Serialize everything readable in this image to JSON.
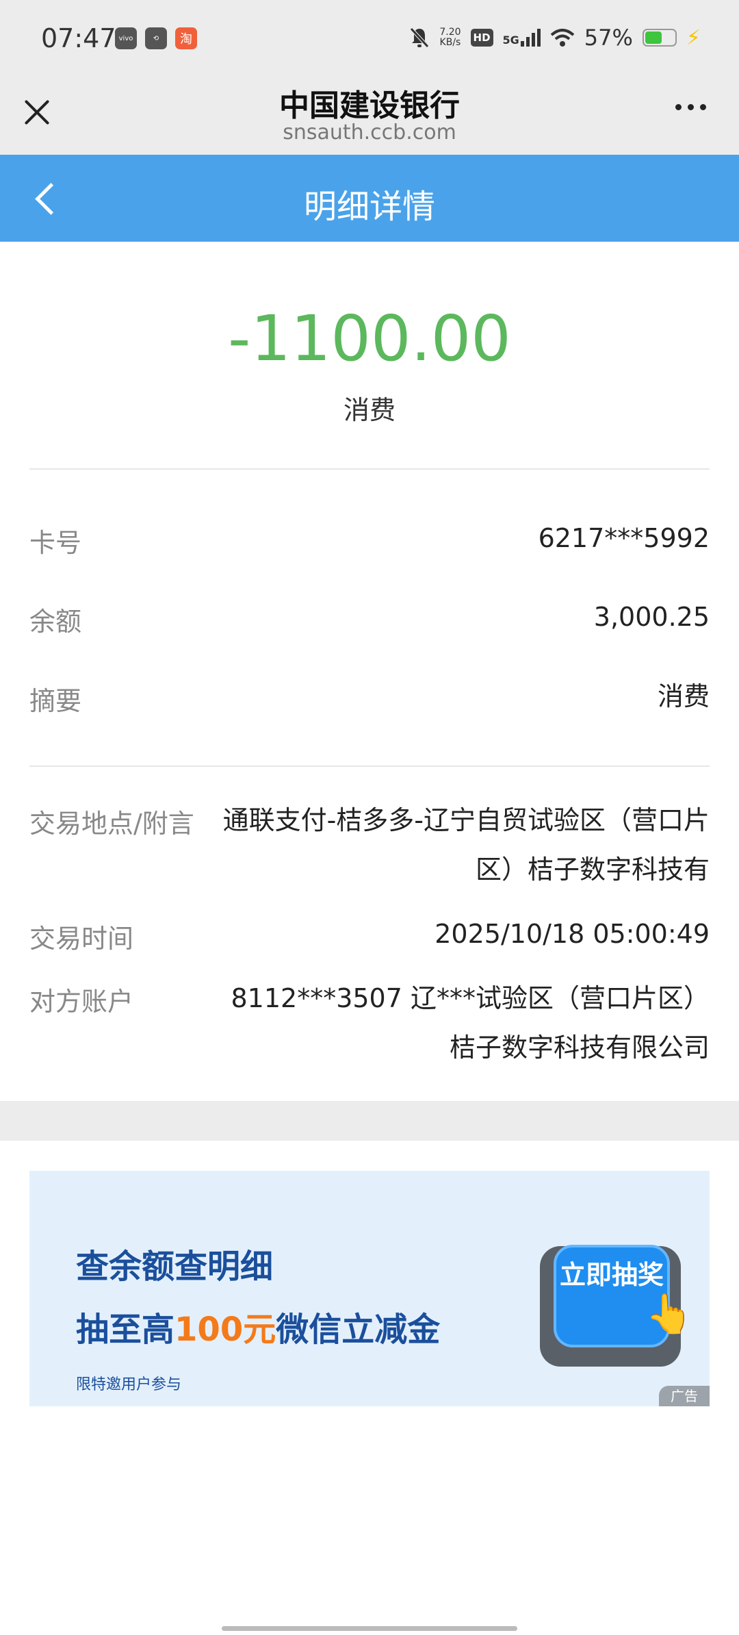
{
  "status_bar": {
    "time": "07:47",
    "left_icons": [
      "vivo-icon",
      "link-icon",
      "taobao-icon"
    ],
    "network_speed": "7.20\nKB/s",
    "hd_label": "HD",
    "network_label": "5G",
    "battery_percent": "57%",
    "battery_level": 0.57,
    "battery_color": "#3ec43e"
  },
  "browser": {
    "title": "中国建设银行",
    "url": "snsauth.ccb.com",
    "close_icon": "close-icon",
    "more_icon": "more-icon"
  },
  "header": {
    "title": "明细详情",
    "background": "#4aa3ea",
    "back_icon": "chevron-left-icon"
  },
  "transaction": {
    "amount": "-1100.00",
    "amount_color": "#5cb85c",
    "type": "消费"
  },
  "details_basic": [
    {
      "label": "卡号",
      "value": "6217***5992"
    },
    {
      "label": "余额",
      "value": "3,000.25"
    },
    {
      "label": "摘要",
      "value": "消费"
    }
  ],
  "details_extra": {
    "location_label": "交易地点/附言",
    "location_value": "通联支付-桔多多-辽宁自贸试验区（营口片区）桔子数字科技有",
    "time_label": "交易时间",
    "time_value": "2025/10/18 05:00:49",
    "counterparty_label": "对方账户",
    "counterparty_value": "8112***3507  辽***试验区（营口片区）桔子数字科技有限公司"
  },
  "ad": {
    "line1": "查余额查明细",
    "line2_pre": "抽至高",
    "line2_highlight": "100元",
    "line2_post": "微信立减金",
    "note": "限特邀用户参与",
    "button_label": "立即抽奖",
    "tag": "广告",
    "highlight_color": "#f47a1a",
    "text_color": "#1b4f9c"
  }
}
